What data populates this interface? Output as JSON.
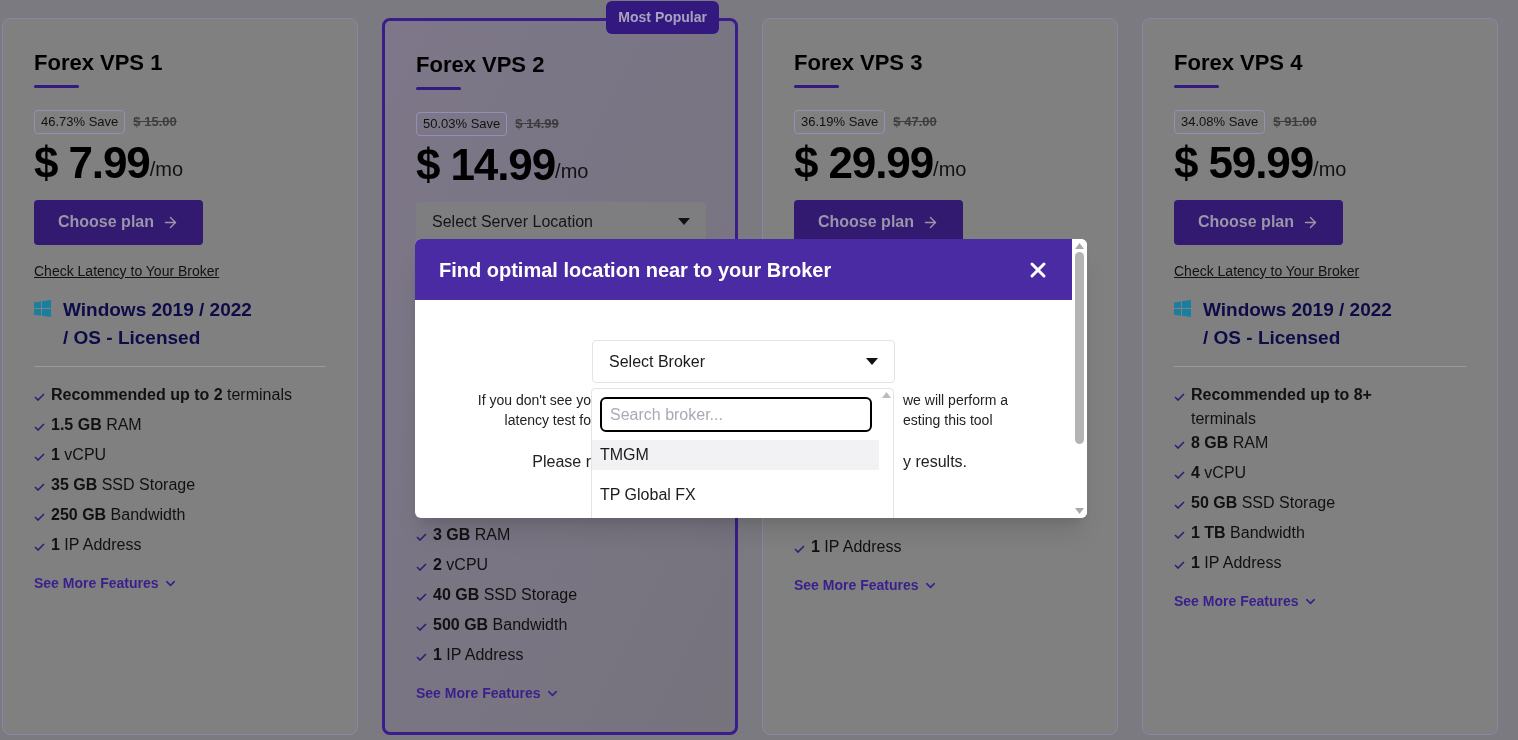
{
  "plans": [
    {
      "name": "Forex VPS 1",
      "featured": false,
      "save": "46.73% Save",
      "old_price": "$ 15.00",
      "price": "$ 7.99",
      "period": "/mo",
      "action": {
        "kind": "button",
        "label": "Choose plan"
      },
      "latency_link": "Check Latency to Your Broker",
      "os": "Windows 2019 / 2022 / OS - Licensed",
      "features": [
        "**Recommended up to 2** terminals",
        "**1.5 GB** RAM",
        "**1** vCPU",
        "**35 GB** SSD Storage",
        "**250 GB** Bandwidth",
        "**1** IP Address"
      ],
      "more": "See More Features"
    },
    {
      "name": "Forex VPS 2",
      "featured": true,
      "badge": "Most Popular",
      "save": "50.03% Save",
      "old_price": "$ 14.99",
      "price": "$ 14.99",
      "period": "/mo",
      "action": {
        "kind": "select",
        "label": "Select Server Location"
      },
      "features": [
        "**3 GB** RAM",
        "**2** vCPU",
        "**40 GB** SSD Storage",
        "**500 GB** Bandwidth",
        "**1** IP Address"
      ],
      "more": "See More Features"
    },
    {
      "name": "Forex VPS 3",
      "featured": false,
      "save": "36.19% Save",
      "old_price": "$ 47.00",
      "price": "$ 29.99",
      "period": "/mo",
      "action": {
        "kind": "button",
        "label": "Choose plan"
      },
      "features": [
        "**1** IP Address"
      ],
      "more": "See More Features"
    },
    {
      "name": "Forex VPS 4",
      "featured": false,
      "save": "34.08% Save",
      "old_price": "$ 91.00",
      "price": "$ 59.99",
      "period": "/mo",
      "action": {
        "kind": "button",
        "label": "Choose plan"
      },
      "latency_link": "Check Latency to Your Broker",
      "os": "Windows 2019 / 2022 / OS - Licensed",
      "features": [
        "**Recommended up to 8+** terminals",
        "**8 GB** RAM",
        "**4** vCPU",
        "**50 GB** SSD Storage",
        "**1 TB** Bandwidth",
        "**1** IP Address"
      ],
      "more": "See More Features"
    }
  ],
  "modal": {
    "title": "Find optimal location near to your Broker",
    "select": {
      "placeholder": "Select Broker"
    },
    "note_left": [
      "If you don't see yo",
      "latency test fo"
    ],
    "note_right": [
      "we will perform a",
      "esting this tool"
    ],
    "please_left": "Please r",
    "please_right": "y results.",
    "dropdown": {
      "search_placeholder": "Search broker...",
      "options": [
        {
          "label": "TMGM",
          "highlighted": true
        },
        {
          "label": "TP Global FX",
          "highlighted": false
        }
      ]
    }
  }
}
